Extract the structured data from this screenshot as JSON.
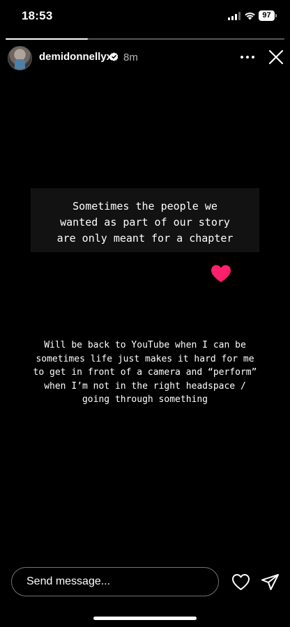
{
  "status_bar": {
    "time": "18:53",
    "battery": "97",
    "icons": [
      "signal-icon",
      "wifi-icon",
      "battery-icon"
    ]
  },
  "story": {
    "progress": 0.295,
    "username": "demidonnellyx",
    "verified": true,
    "time_ago": "8m",
    "header_icons": [
      "more-icon",
      "close-icon"
    ]
  },
  "content": {
    "quote": "Sometimes the people we\nwanted as part of our story\nare only meant for a chapter",
    "sticker": "heart-icon",
    "sticker_color": "#ff1f6a",
    "message": "Will be back to YouTube when I can be\nsometimes life just makes it hard for me\nto get in front of a camera and “perform”\nwhen I’m not in the right headspace /\ngoing through something"
  },
  "reply_bar": {
    "placeholder": "Send message...",
    "icons": [
      "like-icon",
      "share-icon"
    ]
  }
}
